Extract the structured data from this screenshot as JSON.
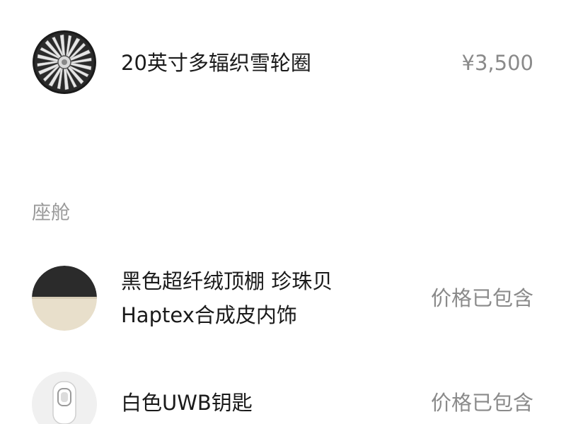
{
  "options": [
    {
      "icon": "wheel-rim-icon",
      "title_lines": [
        "20英寸多辐织雪轮圈"
      ],
      "price": "¥3,500"
    }
  ],
  "cabin": {
    "section_label": "座舱",
    "items": [
      {
        "icon": "interior-swatch-icon",
        "title_lines": [
          "黑色超纤绒顶棚 珍珠贝",
          "Haptex合成皮内饰"
        ],
        "price": "价格已包含"
      },
      {
        "icon": "uwb-key-icon",
        "title_lines": [
          "白色UWB钥匙"
        ],
        "price": "价格已包含"
      }
    ]
  },
  "colors": {
    "text_primary": "#1a1a1a",
    "text_secondary": "#8a8a8a",
    "section_label": "#9a9a9a",
    "background": "#ffffff"
  }
}
